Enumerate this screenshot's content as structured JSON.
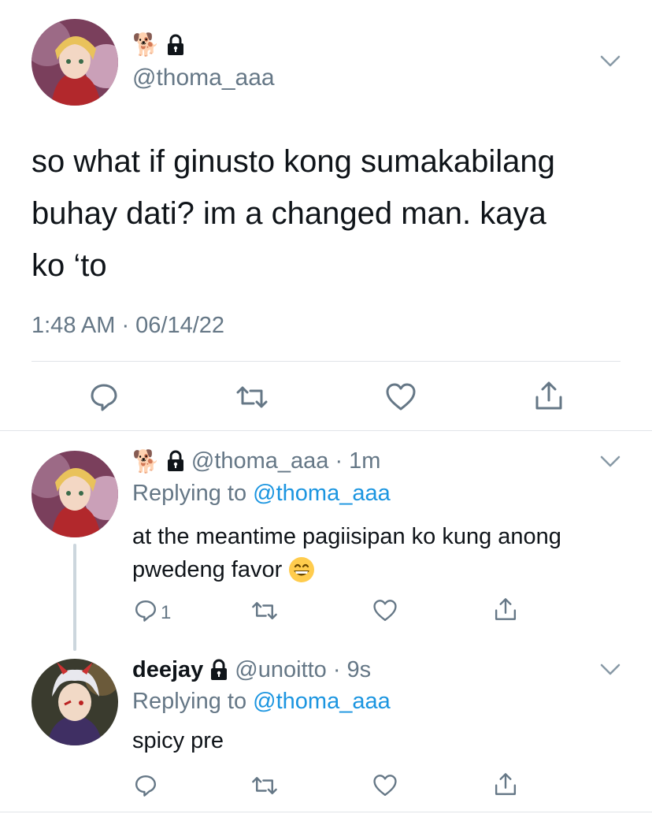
{
  "main_tweet": {
    "name_emoji": "🐕",
    "handle": "@thoma_aaa",
    "text_lines": [
      "so what if ginusto kong sumakabilang",
      "buhay dati? im a changed man. kaya",
      "ko ‘to"
    ],
    "timestamp": "1:48 AM · 06/14/22"
  },
  "reply1": {
    "name_emoji": "🐕",
    "handle": "@thoma_aaa",
    "time": "· 1m",
    "replying_prefix": "Replying to",
    "replying_handle": "@thoma_aaa",
    "text_line1": "at the meantime pagiisipan ko kung anong",
    "text_line2": "pwedeng favor",
    "emoji": "😁",
    "reply_count": "1"
  },
  "reply2": {
    "name": "deejay",
    "handle": "@unoitto",
    "time": "· 9s",
    "replying_prefix": "Replying to",
    "replying_handle": "@thoma_aaa",
    "text": "spicy pre"
  },
  "icons": [
    "dog-icon",
    "lock-icon",
    "chevron-down-icon",
    "reply-icon",
    "retweet-icon",
    "like-icon",
    "share-icon",
    "grin-emoji-icon"
  ],
  "colors": {
    "link": "#1b95e0",
    "muted": "#657786",
    "text": "#0f1419",
    "divider": "#e1e4e8"
  }
}
